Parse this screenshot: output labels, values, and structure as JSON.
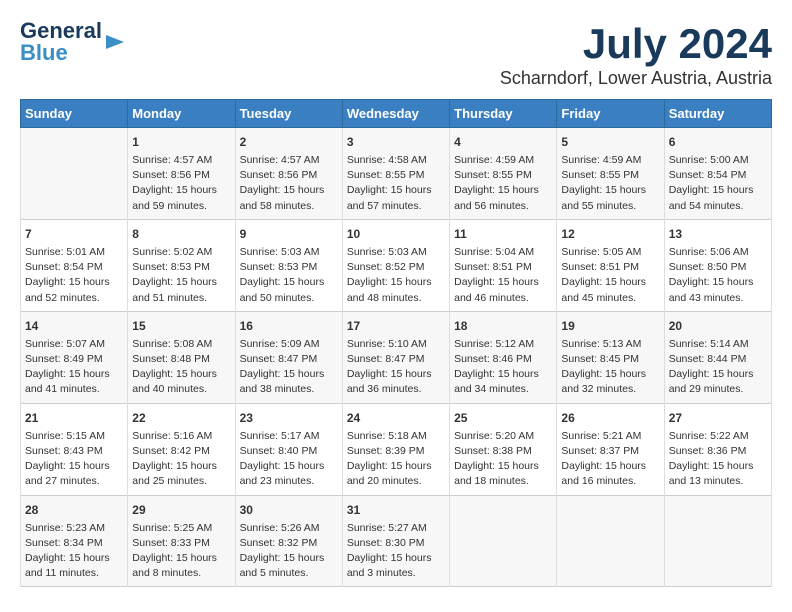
{
  "header": {
    "logo_line1": "General",
    "logo_line2": "Blue",
    "main_title": "July 2024",
    "sub_title": "Scharndorf, Lower Austria, Austria"
  },
  "days_of_week": [
    "Sunday",
    "Monday",
    "Tuesday",
    "Wednesday",
    "Thursday",
    "Friday",
    "Saturday"
  ],
  "weeks": [
    [
      {
        "day": "",
        "content": ""
      },
      {
        "day": "1",
        "content": "Sunrise: 4:57 AM\nSunset: 8:56 PM\nDaylight: 15 hours\nand 59 minutes."
      },
      {
        "day": "2",
        "content": "Sunrise: 4:57 AM\nSunset: 8:56 PM\nDaylight: 15 hours\nand 58 minutes."
      },
      {
        "day": "3",
        "content": "Sunrise: 4:58 AM\nSunset: 8:55 PM\nDaylight: 15 hours\nand 57 minutes."
      },
      {
        "day": "4",
        "content": "Sunrise: 4:59 AM\nSunset: 8:55 PM\nDaylight: 15 hours\nand 56 minutes."
      },
      {
        "day": "5",
        "content": "Sunrise: 4:59 AM\nSunset: 8:55 PM\nDaylight: 15 hours\nand 55 minutes."
      },
      {
        "day": "6",
        "content": "Sunrise: 5:00 AM\nSunset: 8:54 PM\nDaylight: 15 hours\nand 54 minutes."
      }
    ],
    [
      {
        "day": "7",
        "content": "Sunrise: 5:01 AM\nSunset: 8:54 PM\nDaylight: 15 hours\nand 52 minutes."
      },
      {
        "day": "8",
        "content": "Sunrise: 5:02 AM\nSunset: 8:53 PM\nDaylight: 15 hours\nand 51 minutes."
      },
      {
        "day": "9",
        "content": "Sunrise: 5:03 AM\nSunset: 8:53 PM\nDaylight: 15 hours\nand 50 minutes."
      },
      {
        "day": "10",
        "content": "Sunrise: 5:03 AM\nSunset: 8:52 PM\nDaylight: 15 hours\nand 48 minutes."
      },
      {
        "day": "11",
        "content": "Sunrise: 5:04 AM\nSunset: 8:51 PM\nDaylight: 15 hours\nand 46 minutes."
      },
      {
        "day": "12",
        "content": "Sunrise: 5:05 AM\nSunset: 8:51 PM\nDaylight: 15 hours\nand 45 minutes."
      },
      {
        "day": "13",
        "content": "Sunrise: 5:06 AM\nSunset: 8:50 PM\nDaylight: 15 hours\nand 43 minutes."
      }
    ],
    [
      {
        "day": "14",
        "content": "Sunrise: 5:07 AM\nSunset: 8:49 PM\nDaylight: 15 hours\nand 41 minutes."
      },
      {
        "day": "15",
        "content": "Sunrise: 5:08 AM\nSunset: 8:48 PM\nDaylight: 15 hours\nand 40 minutes."
      },
      {
        "day": "16",
        "content": "Sunrise: 5:09 AM\nSunset: 8:47 PM\nDaylight: 15 hours\nand 38 minutes."
      },
      {
        "day": "17",
        "content": "Sunrise: 5:10 AM\nSunset: 8:47 PM\nDaylight: 15 hours\nand 36 minutes."
      },
      {
        "day": "18",
        "content": "Sunrise: 5:12 AM\nSunset: 8:46 PM\nDaylight: 15 hours\nand 34 minutes."
      },
      {
        "day": "19",
        "content": "Sunrise: 5:13 AM\nSunset: 8:45 PM\nDaylight: 15 hours\nand 32 minutes."
      },
      {
        "day": "20",
        "content": "Sunrise: 5:14 AM\nSunset: 8:44 PM\nDaylight: 15 hours\nand 29 minutes."
      }
    ],
    [
      {
        "day": "21",
        "content": "Sunrise: 5:15 AM\nSunset: 8:43 PM\nDaylight: 15 hours\nand 27 minutes."
      },
      {
        "day": "22",
        "content": "Sunrise: 5:16 AM\nSunset: 8:42 PM\nDaylight: 15 hours\nand 25 minutes."
      },
      {
        "day": "23",
        "content": "Sunrise: 5:17 AM\nSunset: 8:40 PM\nDaylight: 15 hours\nand 23 minutes."
      },
      {
        "day": "24",
        "content": "Sunrise: 5:18 AM\nSunset: 8:39 PM\nDaylight: 15 hours\nand 20 minutes."
      },
      {
        "day": "25",
        "content": "Sunrise: 5:20 AM\nSunset: 8:38 PM\nDaylight: 15 hours\nand 18 minutes."
      },
      {
        "day": "26",
        "content": "Sunrise: 5:21 AM\nSunset: 8:37 PM\nDaylight: 15 hours\nand 16 minutes."
      },
      {
        "day": "27",
        "content": "Sunrise: 5:22 AM\nSunset: 8:36 PM\nDaylight: 15 hours\nand 13 minutes."
      }
    ],
    [
      {
        "day": "28",
        "content": "Sunrise: 5:23 AM\nSunset: 8:34 PM\nDaylight: 15 hours\nand 11 minutes."
      },
      {
        "day": "29",
        "content": "Sunrise: 5:25 AM\nSunset: 8:33 PM\nDaylight: 15 hours\nand 8 minutes."
      },
      {
        "day": "30",
        "content": "Sunrise: 5:26 AM\nSunset: 8:32 PM\nDaylight: 15 hours\nand 5 minutes."
      },
      {
        "day": "31",
        "content": "Sunrise: 5:27 AM\nSunset: 8:30 PM\nDaylight: 15 hours\nand 3 minutes."
      },
      {
        "day": "",
        "content": ""
      },
      {
        "day": "",
        "content": ""
      },
      {
        "day": "",
        "content": ""
      }
    ]
  ]
}
